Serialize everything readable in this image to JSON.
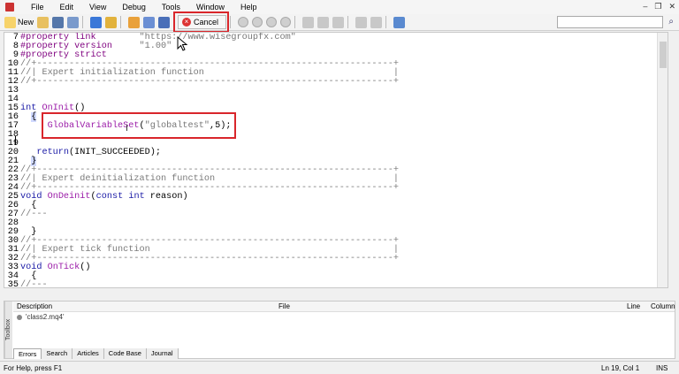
{
  "menu": {
    "items": [
      "File",
      "Edit",
      "View",
      "Debug",
      "Tools",
      "Window",
      "Help"
    ]
  },
  "toolbar": {
    "new_label": "New",
    "cancel_label": "Cancel"
  },
  "editor": {
    "lines": [
      {
        "n": "7",
        "parts": [
          {
            "t": "#property link",
            "c": "c-pre"
          },
          {
            "t": "        \"https://www.wisegroupfx.com\"",
            "c": "c-str"
          }
        ]
      },
      {
        "n": "8",
        "parts": [
          {
            "t": "#property version",
            "c": "c-pre"
          },
          {
            "t": "     \"1.00\"",
            "c": "c-str"
          }
        ]
      },
      {
        "n": "9",
        "parts": [
          {
            "t": "#property strict",
            "c": "c-pre"
          }
        ]
      },
      {
        "n": "10",
        "parts": [
          {
            "t": "//+------------------------------------------------------------------+",
            "c": "c-cmt"
          }
        ]
      },
      {
        "n": "11",
        "parts": [
          {
            "t": "//| Expert initialization function                                   |",
            "c": "c-cmt"
          }
        ]
      },
      {
        "n": "12",
        "parts": [
          {
            "t": "//+------------------------------------------------------------------+",
            "c": "c-cmt"
          }
        ]
      },
      {
        "n": "13",
        "parts": []
      },
      {
        "n": "14",
        "parts": []
      },
      {
        "n": "15",
        "parts": [
          {
            "t": "int",
            "c": "c-kw"
          },
          {
            "t": " ",
            "c": "c-txt"
          },
          {
            "t": "OnInit",
            "c": "c-fn"
          },
          {
            "t": "()",
            "c": "c-txt"
          }
        ]
      },
      {
        "n": "16",
        "parts": [
          {
            "t": "  ",
            "c": "c-txt"
          },
          {
            "t": "{",
            "c": "brace-hl"
          }
        ]
      },
      {
        "n": "17",
        "parts": [
          {
            "t": "     ",
            "c": "c-txt"
          },
          {
            "t": "GlobalVariableSet",
            "c": "c-fn"
          },
          {
            "t": "(",
            "c": "c-txt"
          },
          {
            "t": "\"globaltest\"",
            "c": "c-str"
          },
          {
            "t": ",5);",
            "c": "c-txt"
          }
        ]
      },
      {
        "n": "18",
        "parts": []
      },
      {
        "n": "19",
        "parts": []
      },
      {
        "n": "20",
        "parts": [
          {
            "t": "   ",
            "c": "c-txt"
          },
          {
            "t": "return",
            "c": "c-kw"
          },
          {
            "t": "(INIT_SUCCEEDED);",
            "c": "c-txt"
          }
        ]
      },
      {
        "n": "21",
        "parts": [
          {
            "t": "  ",
            "c": "c-txt"
          },
          {
            "t": "}",
            "c": "brace-hl"
          }
        ]
      },
      {
        "n": "22",
        "parts": [
          {
            "t": "//+------------------------------------------------------------------+",
            "c": "c-cmt"
          }
        ]
      },
      {
        "n": "23",
        "parts": [
          {
            "t": "//| Expert deinitialization function                                 |",
            "c": "c-cmt"
          }
        ]
      },
      {
        "n": "24",
        "parts": [
          {
            "t": "//+------------------------------------------------------------------+",
            "c": "c-cmt"
          }
        ]
      },
      {
        "n": "25",
        "parts": [
          {
            "t": "void",
            "c": "c-kw"
          },
          {
            "t": " ",
            "c": "c-txt"
          },
          {
            "t": "OnDeinit",
            "c": "c-fn"
          },
          {
            "t": "(",
            "c": "c-txt"
          },
          {
            "t": "const",
            "c": "c-kw"
          },
          {
            "t": " ",
            "c": "c-txt"
          },
          {
            "t": "int",
            "c": "c-kw"
          },
          {
            "t": " reason)",
            "c": "c-txt"
          }
        ]
      },
      {
        "n": "26",
        "parts": [
          {
            "t": "  {",
            "c": "c-txt"
          }
        ]
      },
      {
        "n": "27",
        "parts": [
          {
            "t": "//---",
            "c": "c-cmt"
          }
        ]
      },
      {
        "n": "28",
        "parts": []
      },
      {
        "n": "29",
        "parts": [
          {
            "t": "  }",
            "c": "c-txt"
          }
        ]
      },
      {
        "n": "30",
        "parts": [
          {
            "t": "//+------------------------------------------------------------------+",
            "c": "c-cmt"
          }
        ]
      },
      {
        "n": "31",
        "parts": [
          {
            "t": "//| Expert tick function                                             |",
            "c": "c-cmt"
          }
        ]
      },
      {
        "n": "32",
        "parts": [
          {
            "t": "//+------------------------------------------------------------------+",
            "c": "c-cmt"
          }
        ]
      },
      {
        "n": "33",
        "parts": [
          {
            "t": "void",
            "c": "c-kw"
          },
          {
            "t": " ",
            "c": "c-txt"
          },
          {
            "t": "OnTick",
            "c": "c-fn"
          },
          {
            "t": "()",
            "c": "c-txt"
          }
        ]
      },
      {
        "n": "34",
        "parts": [
          {
            "t": "  {",
            "c": "c-txt"
          }
        ]
      },
      {
        "n": "35",
        "parts": [
          {
            "t": "//---",
            "c": "c-cmt"
          }
        ]
      }
    ]
  },
  "toolbox": {
    "side_label": "Toolbox",
    "col_description": "Description",
    "col_file": "File",
    "col_line": "Line",
    "col_column": "Column",
    "row_text": "'class2.mq4'",
    "tabs": [
      "Errors",
      "Search",
      "Articles",
      "Code Base",
      "Journal"
    ]
  },
  "status": {
    "help_text": "For Help, press F1",
    "position": "Ln 19, Col 1",
    "mode": "INS"
  }
}
